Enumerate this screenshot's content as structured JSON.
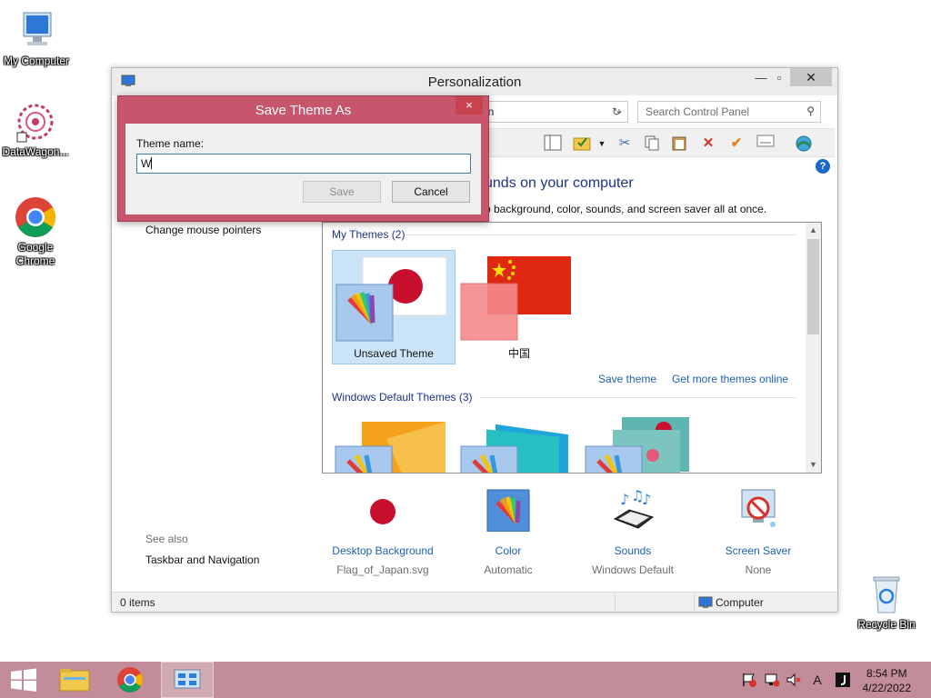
{
  "desktop": {
    "icons": [
      {
        "label": "My Computer"
      },
      {
        "label": "DataWagon..."
      },
      {
        "label": "Google Chrome"
      },
      {
        "label": "Recycle Bin"
      }
    ]
  },
  "window": {
    "title": "Personalization",
    "address_text": "on",
    "search_placeholder": "Search Control Panel",
    "heading": "unds on your computer",
    "subheading": "p background, color, sounds, and screen saver all at once.",
    "left_links": [
      "Change mouse pointers"
    ],
    "see_also_label": "See also",
    "see_also_links": [
      "Taskbar and Navigation"
    ],
    "my_themes_label": "My Themes (2)",
    "my_themes": [
      {
        "name": "Unsaved Theme",
        "selected": true
      },
      {
        "name": "中国",
        "selected": false
      }
    ],
    "save_theme_link": "Save theme",
    "get_more_link": "Get more themes online",
    "default_themes_label": "Windows Default Themes (3)",
    "settings": [
      {
        "name": "Desktop Background",
        "value": "Flag_of_Japan.svg",
        "icon": "japan-flag-icon"
      },
      {
        "name": "Color",
        "value": "Automatic",
        "icon": "color-palette-icon"
      },
      {
        "name": "Sounds",
        "value": "Windows Default",
        "icon": "sounds-icon"
      },
      {
        "name": "Screen Saver",
        "value": "None",
        "icon": "screen-saver-icon"
      }
    ],
    "status": {
      "items": "0 items",
      "location": "Computer"
    }
  },
  "dialog": {
    "title": "Save Theme As",
    "label": "Theme name:",
    "input_value": "W",
    "save_label": "Save",
    "cancel_label": "Cancel",
    "close_glyph": "×"
  },
  "taskbar": {
    "time": "8:54 PM",
    "date": "4/22/2022",
    "ime_label": "A"
  },
  "colors": {
    "dialog_accent": "#c7566d",
    "taskbar": "#c28c9a",
    "link": "#1e5fb0",
    "heading": "#1e3287"
  }
}
